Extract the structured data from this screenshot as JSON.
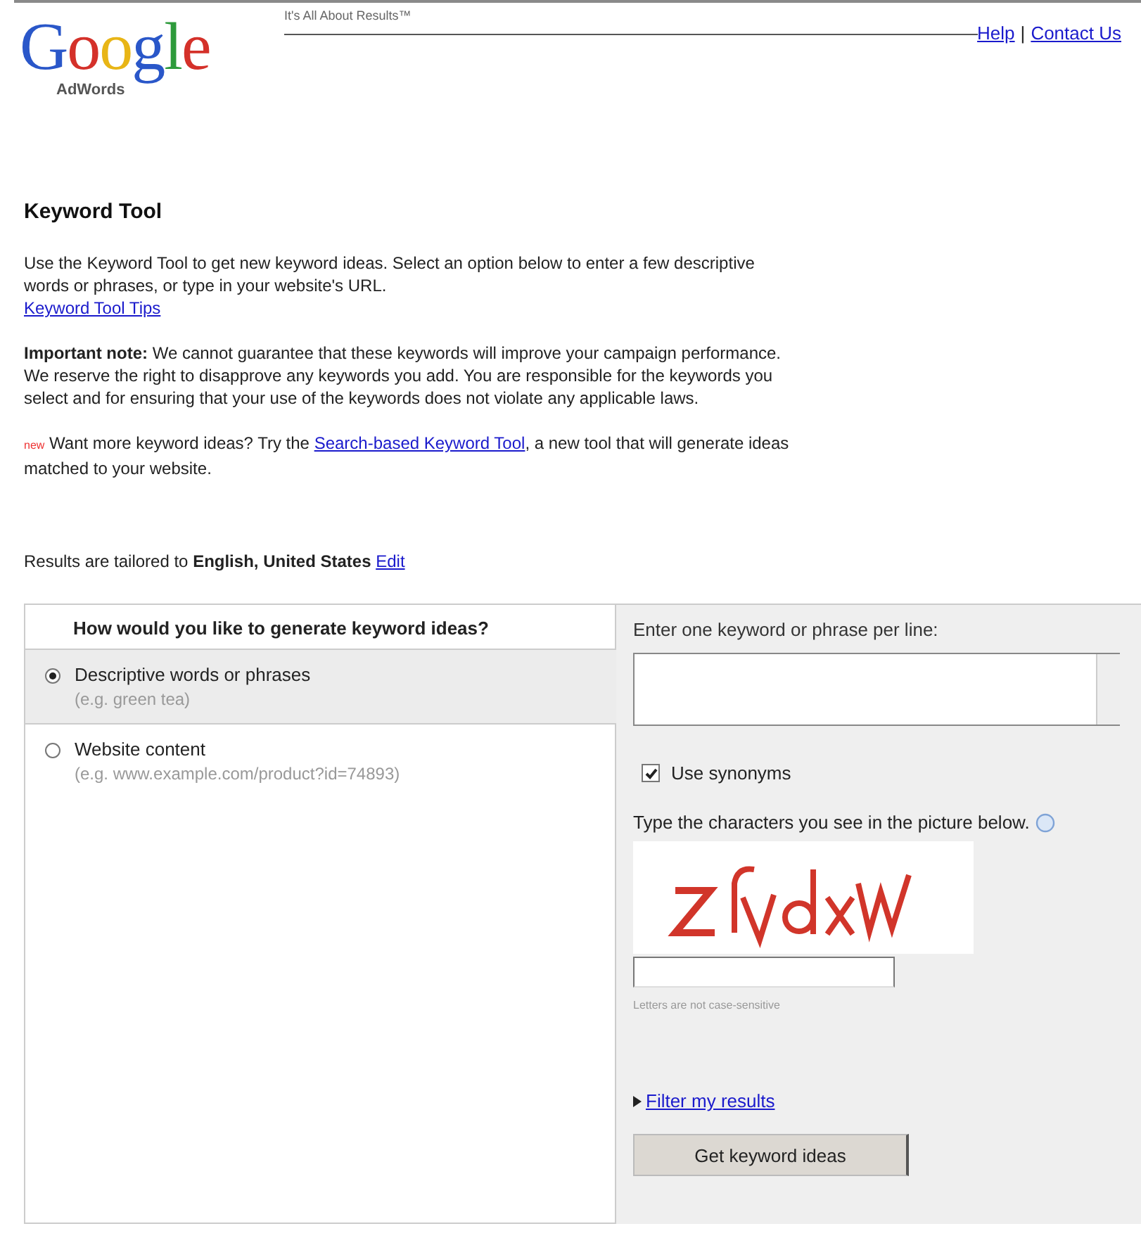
{
  "header": {
    "logo": {
      "wordmark": "Google",
      "product": "AdWords"
    },
    "tagline": "It's All About Results™",
    "links": [
      "Help",
      "Contact Us"
    ],
    "separator": "|"
  },
  "page_title": "Keyword Tool",
  "intro": {
    "text": "Use the Keyword Tool to get new keyword ideas. Select an option below to enter a few descriptive words or phrases, or type in your website's URL.",
    "link": "Keyword Tool Tips"
  },
  "note": "**Important note:** We cannot guarantee that these keywords will improve your campaign performance. We reserve the right to disapprove any keywords you add. You are responsible for the keywords you select and for ensuring that your use of the keywords does not violate any applicable laws.",
  "promo": {
    "badge": "new",
    "before": "Want more keyword ideas? Try the ",
    "link": "Search-based Keyword Tool",
    "after": ", a new tool that will generate ideas matched to your website."
  },
  "tailored": {
    "text": "Results are tailored to **English, United States**",
    "link": "Edit"
  },
  "options_panel": {
    "heading": "How would you like to generate keyword ideas?",
    "options": [
      {
        "label": "Descriptive words or phrases",
        "example": "(e.g. green tea)",
        "selected": true
      },
      {
        "label": "Website content",
        "example": "(e.g. www.example.com/product?id=74893)",
        "selected": false
      }
    ]
  },
  "input_panel": {
    "heading": "Enter one keyword or phrase per line:",
    "synonyms": {
      "label": "Use synonyms",
      "checked": true
    },
    "captcha": {
      "prompt": "Type the characters you see in the picture below.",
      "hint": "Letters are not case-sensitive"
    },
    "filter_link": "Filter my results",
    "submit": "Get keyword ideas"
  }
}
